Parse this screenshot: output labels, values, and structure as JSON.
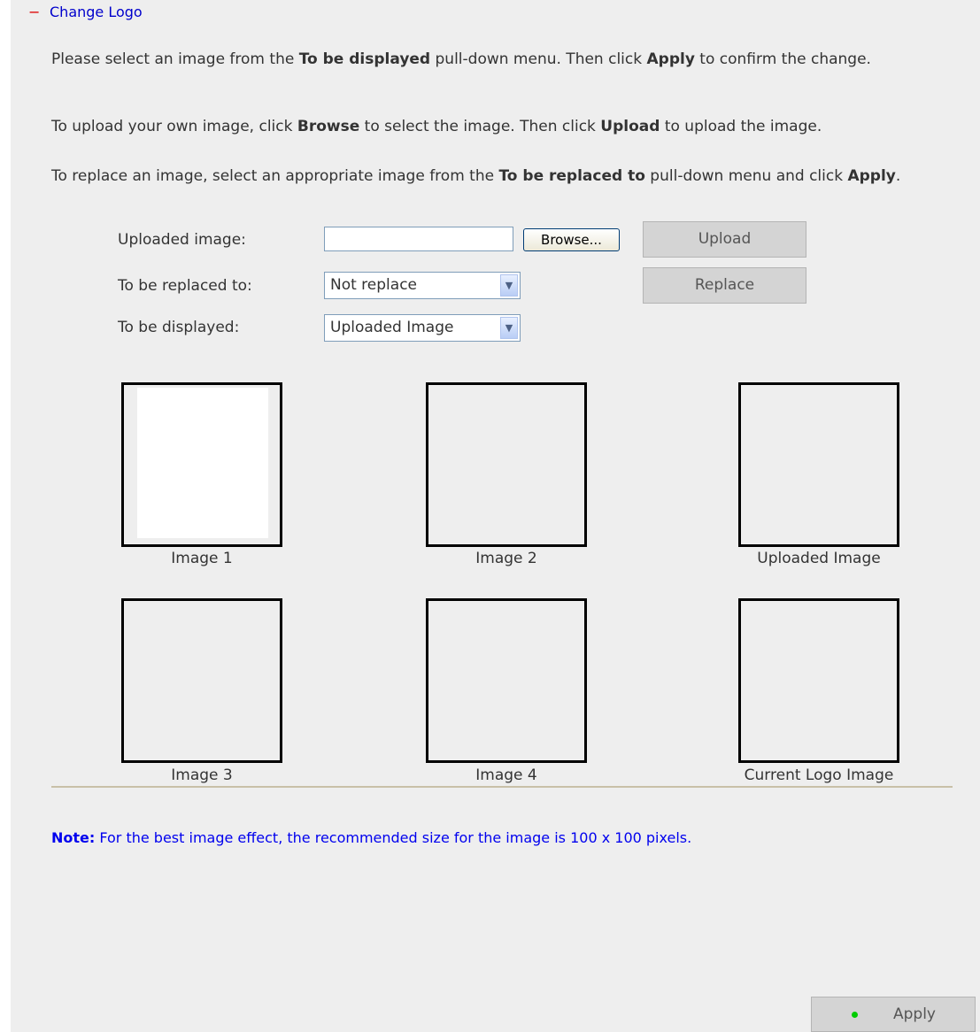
{
  "section": {
    "collapse_symbol": "−",
    "title": "Change Logo"
  },
  "instructions": {
    "p1": [
      "Please select an image from the ",
      "To be displayed",
      " pull-down menu. Then click ",
      "Apply",
      " to confirm the change."
    ],
    "p2": [
      "To upload your own image, click ",
      "Browse",
      " to select the image. Then click ",
      "Upload",
      " to upload the image."
    ],
    "p3": [
      "To replace an image, select an appropriate image from the ",
      "To be replaced to",
      " pull-down menu and click ",
      "Apply",
      "."
    ]
  },
  "form": {
    "uploaded_label": "Uploaded image:",
    "uploaded_value": "",
    "browse_label": "Browse...",
    "upload_label": "Upload",
    "replaced_label": "To be replaced to:",
    "replaced_value": "Not replace",
    "replace_label": "Replace",
    "displayed_label": "To be displayed:",
    "displayed_value": "Uploaded Image"
  },
  "images": [
    {
      "caption": "Image 1"
    },
    {
      "caption": "Image 2"
    },
    {
      "caption": "Uploaded Image"
    },
    {
      "caption": "Image 3"
    },
    {
      "caption": "Image 4"
    },
    {
      "caption": "Current Logo Image"
    }
  ],
  "note": {
    "label": "Note:",
    "text": " For the best image effect, the recommended size for the image is 100 x 100 pixels."
  },
  "footer": {
    "apply_label": "Apply"
  },
  "colors": {
    "panel_bg": "#eeeeee",
    "link_blue": "#0000cc",
    "note_blue": "#0000ee",
    "collapse_red": "#dd0000",
    "apply_dot_green": "#00cc00"
  }
}
